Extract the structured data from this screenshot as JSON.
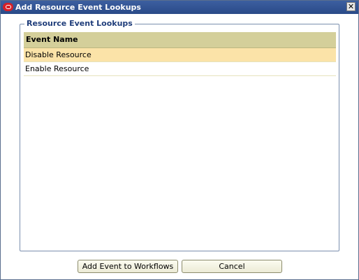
{
  "window": {
    "title": "Add Resource Event Lookups",
    "close_label": "✕"
  },
  "group": {
    "label": "Resource Event Lookups"
  },
  "table": {
    "header": "Event Name",
    "rows": [
      {
        "label": "Disable Resource",
        "selected": true
      },
      {
        "label": "Enable Resource",
        "selected": false
      }
    ]
  },
  "buttons": {
    "add_label": "Add Event to Workflows",
    "cancel_label": "Cancel"
  }
}
